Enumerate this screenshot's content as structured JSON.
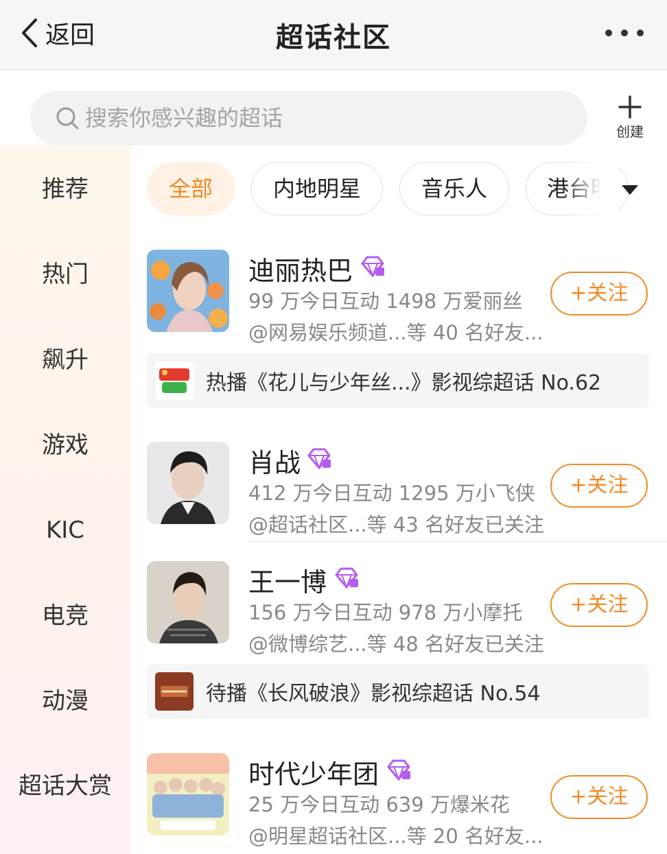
{
  "nav": {
    "back_label": "返回",
    "title": "超话社区",
    "back_icon": "chevron-left-icon",
    "more_icon": "more-dots-icon"
  },
  "search": {
    "placeholder": "搜索你感兴趣的超话",
    "icon": "search-icon"
  },
  "create": {
    "label": "创建",
    "icon": "plus-icon"
  },
  "sidebar": {
    "items": [
      {
        "label": "推荐"
      },
      {
        "label": "热门"
      },
      {
        "label": "飙升"
      },
      {
        "label": "游戏"
      },
      {
        "label": "KIC"
      },
      {
        "label": "电竞"
      },
      {
        "label": "动漫"
      },
      {
        "label": "超话大赏"
      }
    ]
  },
  "chips": {
    "items": [
      {
        "label": "全部",
        "active": true
      },
      {
        "label": "内地明星",
        "active": false
      },
      {
        "label": "音乐人",
        "active": false
      },
      {
        "label": "港台明",
        "active": false
      }
    ],
    "more_icon": "caret-down-icon"
  },
  "cards": [
    {
      "name": "迪丽热巴",
      "stats": "99 万今日互动 1498 万爱丽丝",
      "friends": "@网易娱乐频道...等 40 名好友...",
      "follow": "+关注"
    },
    {
      "name": "肖战",
      "stats": "412 万今日互动 1295 万小飞侠",
      "friends": "@超话社区...等 43 名好友已关注",
      "follow": "+关注"
    },
    {
      "name": "王一博",
      "stats": "156 万今日互动 978 万小摩托",
      "friends": "@微博综艺...等 48 名好友已关注",
      "follow": "+关注"
    },
    {
      "name": "时代少年团",
      "stats": "25 万今日互动 639 万爆米花",
      "friends": "@明星超话社区...等 20 名好友...",
      "follow": "+关注"
    }
  ],
  "promos": [
    {
      "text": "热播《花儿与少年丝...》影视综超话 No.62"
    },
    {
      "text": "待播《长风破浪》影视综超话 No.54"
    }
  ],
  "colors": {
    "accent": "#f08a24",
    "diamond": "#b45cf0",
    "secondary_text": "#888888",
    "nav_bg": "#f6f6f6"
  }
}
